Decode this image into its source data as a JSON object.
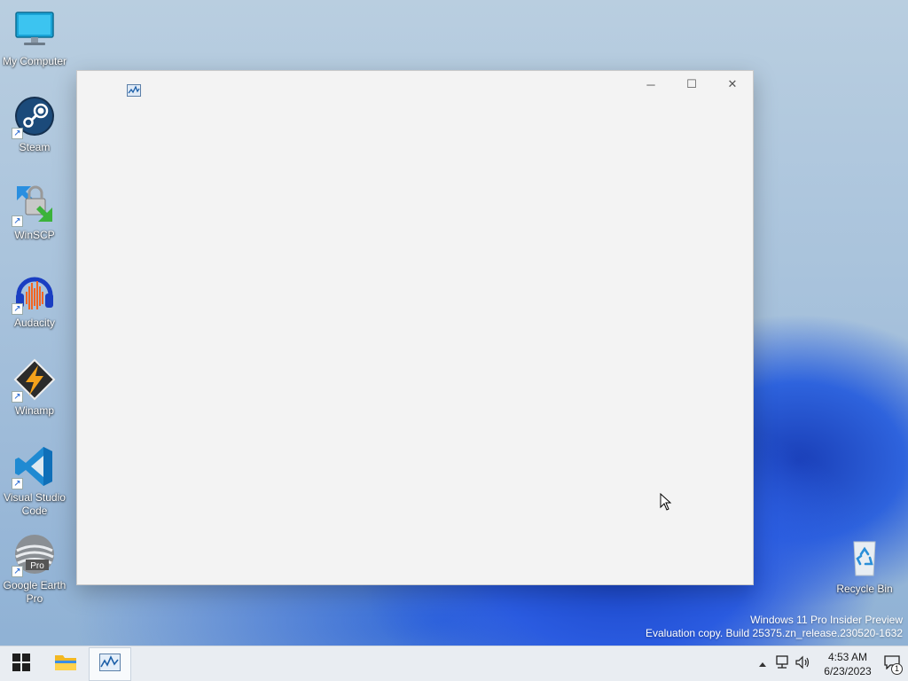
{
  "desktop": {
    "icons": [
      {
        "label": "My Computer"
      },
      {
        "label": "Steam"
      },
      {
        "label": "WinSCP"
      },
      {
        "label": "Audacity"
      },
      {
        "label": "Winamp"
      },
      {
        "label": "Visual Studio Code"
      },
      {
        "label": "Google Earth Pro"
      },
      {
        "label": "Recycle Bin"
      }
    ]
  },
  "window": {
    "icon": "performance-monitor-icon",
    "controls": {
      "minimize": "─",
      "maximize": "☐",
      "close": "✕"
    }
  },
  "watermark": {
    "line1": "Windows 11 Pro Insider Preview",
    "line2": "Evaluation copy. Build 25375.zn_release.230520-1632"
  },
  "taskbar": {
    "start_icon": "windows-start-icon",
    "pinned": [
      "file-explorer-icon",
      "performance-monitor-icon"
    ],
    "tray": {
      "time": "4:53 AM",
      "date": "6/23/2023",
      "notification_count": "1"
    }
  },
  "colors": {
    "taskbar_bg": "#e9edf2",
    "window_bg": "#f3f3f3",
    "accent": "#1a5fd0"
  }
}
